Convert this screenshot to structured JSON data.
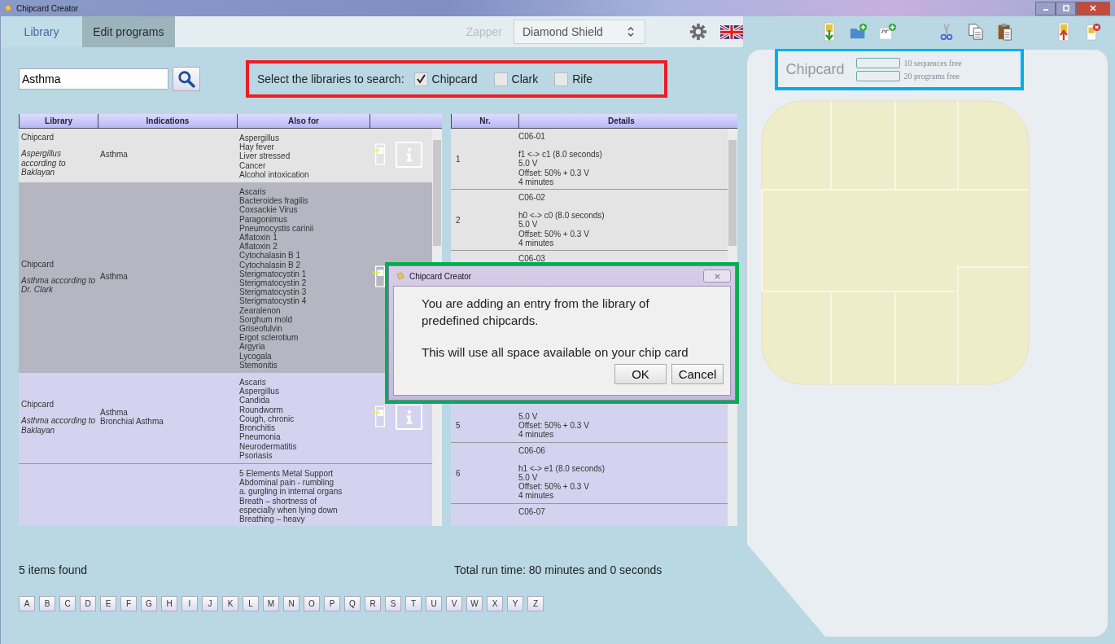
{
  "window": {
    "title": "Chipcard Creator"
  },
  "tabs": [
    {
      "label": "Library",
      "selected": true
    },
    {
      "label": "Edit programs",
      "selected": false
    }
  ],
  "zapper": {
    "label": "Zapper",
    "value": "Diamond Shield"
  },
  "search": {
    "value": "Asthma"
  },
  "filter": {
    "label": "Select the libraries to search:",
    "libraries": [
      {
        "label": "Chipcard",
        "checked": true
      },
      {
        "label": "Clark",
        "checked": false
      },
      {
        "label": "Rife",
        "checked": false
      }
    ]
  },
  "library_table": {
    "columns": [
      "Library",
      "Indications",
      "Also for"
    ],
    "rows": [
      {
        "library": "Chipcard",
        "name": "Aspergillus according to Baklayan",
        "indications": [
          "Asthma"
        ],
        "also_for": [
          "Aspergillus",
          "Hay fever",
          "Liver stressed",
          "Cancer",
          "Alcohol intoxication"
        ],
        "actions": true,
        "hovered": true,
        "selected": false
      },
      {
        "library": "Chipcard",
        "name": "Asthma according to Dr. Clark",
        "indications": [
          "Asthma"
        ],
        "also_for": [
          "Ascaris",
          "Bacteroides fragilis",
          "Coxsackie Virus",
          "Paragonimus",
          "Pneumocystis carinii",
          "Aflatoxin 1",
          "Aflatoxin 2",
          "Cytochalasin B 1",
          "Cytochalasin B 2",
          "Sterigmatocystin 1",
          "Sterigmatocystin 2",
          "Sterigmatocystin 3",
          "Sterigmatocystin 4",
          "Zearalenon",
          "Sorghum mold",
          "Griseofulvin",
          "Ergot sclerotium",
          "Argyria",
          "Lycogala",
          "Stemonitis"
        ],
        "actions": true,
        "hovered": false,
        "selected": true
      },
      {
        "library": "Chipcard",
        "name": "Asthma according to Baklayan",
        "indications": [
          "Asthma",
          "Bronchial Asthma"
        ],
        "also_for": [
          "Ascaris",
          "Aspergillus",
          "Candida",
          "Roundworm",
          "Cough, chronic",
          "Bronchitis",
          "Pneumonia",
          "Neurodermatitis",
          "Psoriasis"
        ],
        "actions": true,
        "hovered": false,
        "selected": false
      },
      {
        "also_for": [
          "5 Elements Metal Support",
          "Abdominal pain - rumbling",
          "a. gurgling in internal organs",
          "Breath – shortness of",
          "especially when lying down",
          "Breathing – heavy"
        ],
        "actions": false,
        "hovered": false,
        "selected": false
      }
    ]
  },
  "program_table": {
    "columns": [
      "Nr.",
      "Details"
    ],
    "rows": [
      {
        "nr": "1",
        "code": "C06-01",
        "lines": [
          "f1 <-> c1 (8.0 seconds)",
          "5.0 V",
          "Offset: 50% + 0.3 V",
          "4 minutes"
        ]
      },
      {
        "nr": "2",
        "code": "C06-02",
        "lines": [
          "h0 <-> c0 (8.0 seconds)",
          "5.0 V",
          "Offset: 50% + 0.3 V",
          "4 minutes"
        ]
      },
      {
        "code": "C06-03"
      },
      {
        "nr": "5",
        "lines": [
          "5.0 V",
          "Offset: 50% + 0.3 V",
          "4 minutes"
        ]
      },
      {
        "nr": "6",
        "code": "C06-06",
        "lines": [
          "h1 <-> e1 (8.0 seconds)",
          "5.0 V",
          "Offset: 50% + 0.3 V",
          "4 minutes"
        ]
      },
      {
        "code": "C06-07"
      }
    ]
  },
  "items_found": "5 items found",
  "total_run_time": "Total run time: 80 minutes and 0 seconds",
  "letters": [
    "A",
    "B",
    "C",
    "D",
    "E",
    "F",
    "G",
    "H",
    "I",
    "J",
    "K",
    "L",
    "M",
    "N",
    "O",
    "P",
    "Q",
    "R",
    "S",
    "T",
    "U",
    "V",
    "W",
    "X",
    "Y",
    "Z"
  ],
  "chipcard": {
    "title": "Chipcard",
    "meters": [
      {
        "label": "10 sequences free"
      },
      {
        "label": "20 programs free"
      }
    ]
  },
  "dialog": {
    "title": "Chipcard Creator",
    "paragraphs": [
      "You are adding an entry from the library of predefined chipcards.",
      "This will use all space available on your chip card"
    ],
    "buttons": [
      "OK",
      "Cancel"
    ]
  }
}
